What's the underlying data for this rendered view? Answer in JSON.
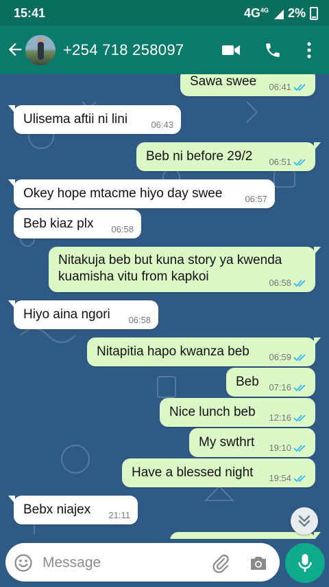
{
  "status_bar": {
    "time": "15:41",
    "network": "4G",
    "network_small": "4G",
    "battery": "2%"
  },
  "header": {
    "contact": "+254 718 258097"
  },
  "messages": [
    {
      "dir": "out",
      "text": "Sawa swee",
      "time": "06:41",
      "read": true
    },
    {
      "dir": "in",
      "text": "Ulisema aftii ni lini",
      "time": "06:43"
    },
    {
      "dir": "out",
      "text": "Beb ni before 29/2",
      "time": "06:51",
      "read": true
    },
    {
      "dir": "in",
      "text": "Okey hope mtacme hiyo day swee",
      "time": "06:57"
    },
    {
      "dir": "in",
      "text": "Beb kiaz plx",
      "time": "06:58"
    },
    {
      "dir": "out",
      "text_line1": "Nitakuja beb but kuna story ya kwenda",
      "text_line2": "kuamisha vitu from kapkoi",
      "time": "06:58",
      "read": true
    },
    {
      "dir": "in",
      "text": "Hiyo aina ngori",
      "time": "06:58"
    },
    {
      "dir": "out",
      "text": "Nitapitia hapo kwanza beb",
      "time": "06:59",
      "read": true
    },
    {
      "dir": "out",
      "text": "Beb",
      "time": "07:16",
      "read": true
    },
    {
      "dir": "out",
      "text": "Nice lunch beb",
      "time": "12:16",
      "read": true
    },
    {
      "dir": "out",
      "text": "My swthrt",
      "time": "19:10",
      "read": true
    },
    {
      "dir": "out",
      "text": "Have a blessed night",
      "time": "19:54",
      "read": true
    },
    {
      "dir": "in",
      "text": "Bebx niajex",
      "time": "21:11"
    }
  ],
  "input": {
    "placeholder": "Message"
  },
  "colors": {
    "header": "#0a7a6a",
    "status_bar": "#0a6e5f",
    "chat_bg": "#2f5a86",
    "outgoing": "#dcf8c6",
    "incoming": "#ffffff",
    "tick_read": "#34b7f1",
    "mic": "#0cab8c"
  }
}
